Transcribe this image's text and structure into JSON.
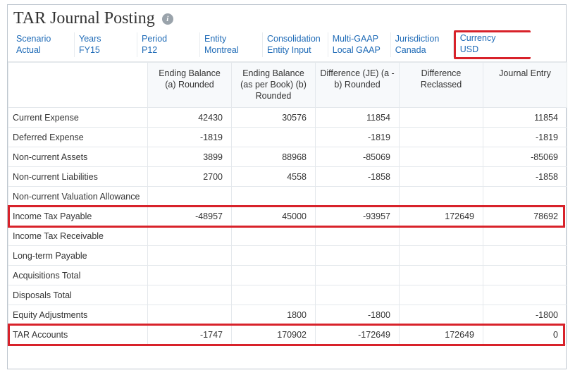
{
  "title": "TAR Journal Posting",
  "pov": [
    {
      "label": "Scenario",
      "value": "Actual"
    },
    {
      "label": "Years",
      "value": "FY15"
    },
    {
      "label": "Period",
      "value": "P12"
    },
    {
      "label": "Entity",
      "value": "Montreal"
    },
    {
      "label": "Consolidation",
      "value": "Entity Input"
    },
    {
      "label": "Multi-GAAP",
      "value": "Local GAAP"
    },
    {
      "label": "Jurisdiction",
      "value": "Canada"
    },
    {
      "label": "Currency",
      "value": "USD"
    }
  ],
  "columns": [
    "Ending Balance (a) Rounded",
    "Ending Balance (as per Book) (b) Rounded",
    "Difference (JE) (a - b) Rounded",
    "Difference Reclassed",
    "Journal Entry"
  ],
  "rows": [
    {
      "label": "Current Expense",
      "v": [
        "42430",
        "30576",
        "11854",
        "",
        "11854"
      ]
    },
    {
      "label": "Deferred Expense",
      "v": [
        "-1819",
        "",
        "-1819",
        "",
        "-1819"
      ]
    },
    {
      "label": "Non-current Assets",
      "v": [
        "3899",
        "88968",
        "-85069",
        "",
        "-85069"
      ]
    },
    {
      "label": "Non-current Liabilities",
      "v": [
        "2700",
        "4558",
        "-1858",
        "",
        "-1858"
      ]
    },
    {
      "label": "Non-current Valuation Allowance",
      "v": [
        "",
        "",
        "",
        "",
        ""
      ]
    },
    {
      "label": "Income Tax Payable",
      "v": [
        "-48957",
        "45000",
        "-93957",
        "172649",
        "78692"
      ]
    },
    {
      "label": "Income Tax Receivable",
      "v": [
        "",
        "",
        "",
        "",
        ""
      ]
    },
    {
      "label": "Long-term Payable",
      "v": [
        "",
        "",
        "",
        "",
        ""
      ]
    },
    {
      "label": "Acquisitions Total",
      "v": [
        "",
        "",
        "",
        "",
        ""
      ]
    },
    {
      "label": "Disposals Total",
      "v": [
        "",
        "",
        "",
        "",
        ""
      ]
    },
    {
      "label": "Equity Adjustments",
      "v": [
        "",
        "1800",
        "-1800",
        "",
        "-1800"
      ]
    },
    {
      "label": "TAR Accounts",
      "v": [
        "-1747",
        "170902",
        "-172649",
        "172649",
        "0"
      ]
    }
  ]
}
